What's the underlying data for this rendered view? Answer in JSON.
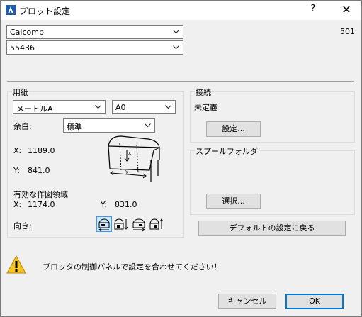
{
  "window": {
    "title": "プロット設定",
    "help_glyph": "?",
    "close_glyph": "✕"
  },
  "plotter": {
    "name": "Calcomp",
    "model": "55436",
    "code": "501"
  },
  "paper": {
    "group_label": "用紙",
    "unit": "メートルA",
    "size": "A0",
    "margin_label": "余白:",
    "margin_value": "標準",
    "x_label": "X:",
    "x_value": "1189.0",
    "y_label": "Y:",
    "y_value": "841.0",
    "effective_area_label": "有効な作図領域",
    "eff_x_label": "X:",
    "eff_x_value": "1174.0",
    "eff_y_label": "Y:",
    "eff_y_value": "831.0",
    "orientation_label": "向き:",
    "orientation_selected_index": 0
  },
  "connection": {
    "group_label": "接続",
    "status": "未定義",
    "settings_button": "設定..."
  },
  "spool": {
    "group_label": "スプールフォルダ",
    "select_button": "選択..."
  },
  "defaults_button": "デフォルトの設定に戻る",
  "warning": {
    "icon": "warning-icon",
    "message": "プロッタの制御パネルで設定を合わせてください！"
  },
  "footer": {
    "cancel": "キャンセル",
    "ok": "OK"
  },
  "colors": {
    "accent": "#0078d7",
    "selection": "#cce8ff",
    "warning": "#f6c624"
  }
}
